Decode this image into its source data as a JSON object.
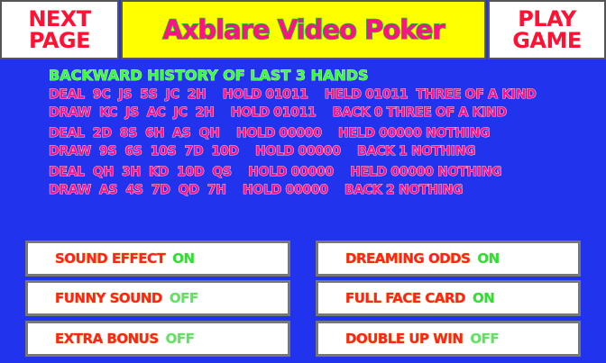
{
  "header": {
    "next_line1": "NEXT",
    "next_line2": "PAGE",
    "title": "Axblare Video Poker",
    "play_line1": "PLAY",
    "play_line2": "GAME"
  },
  "history": {
    "title": "BACKWARD HISTORY OF LAST 3 HANDS",
    "hands": [
      {
        "deal": "DEAL  9C  JS  5S  JC  2H    HOLD 01011    HELD 01011  THREE OF A KIND",
        "draw": "DRAW  KC  JS  AC  JC  2H    HOLD 01011    BACK 0 THREE OF A KIND"
      },
      {
        "deal": "DEAL  2D  8S  6H  AS  QH    HOLD 00000    HELD 00000 NOTHING",
        "draw": "DRAW  9S  6S  10S  7D  10D    HOLD 00000    BACK 1 NOTHING"
      },
      {
        "deal": "DEAL  QH  3H  KD  10D  QS    HOLD 00000    HELD 00000 NOTHING",
        "draw": "DRAW  AS  4S  7D  QD  7H    HOLD 00000    BACK 2 NOTHING"
      }
    ]
  },
  "options": {
    "sound_effect": {
      "label": "SOUND EFFECT",
      "value": "ON"
    },
    "funny_sound": {
      "label": "FUNNY SOUND",
      "value": "OFF"
    },
    "extra_bonus": {
      "label": "EXTRA BONUS",
      "value": "OFF"
    },
    "dreaming_odds": {
      "label": "DREAMING ODDS",
      "value": "ON"
    },
    "full_face_card": {
      "label": "FULL FACE CARD",
      "value": "ON"
    },
    "double_up_win": {
      "label": "DOUBLE UP WIN",
      "value": "OFF"
    }
  },
  "colors": {
    "background": "#2233ee",
    "title_bar": "#ffff00",
    "accent_red": "#ff1133",
    "accent_green": "#33ff33"
  }
}
